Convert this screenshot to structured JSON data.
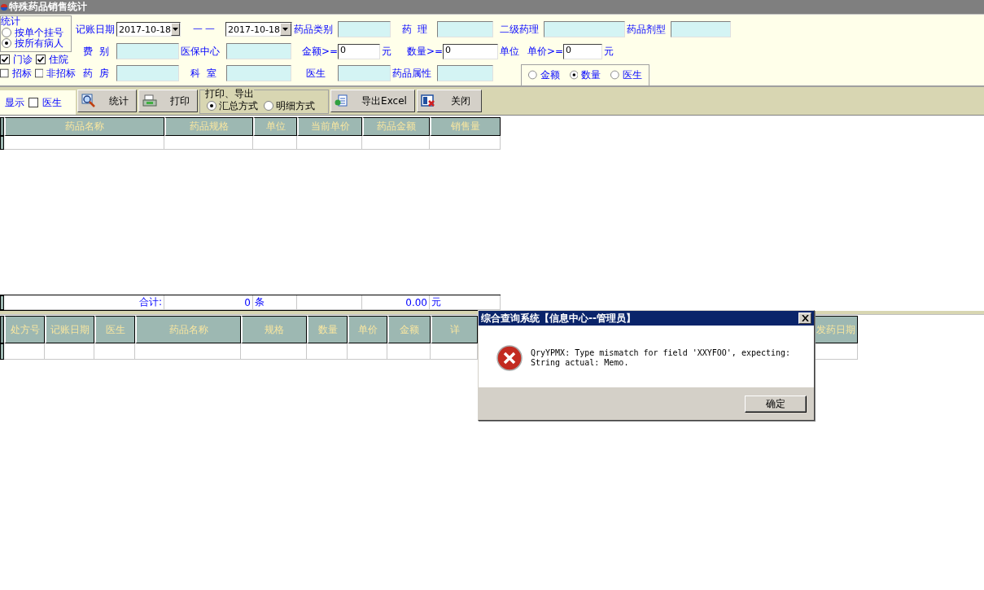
{
  "window": {
    "title": "特殊药品销售统计"
  },
  "stat_group": {
    "legend": "统计",
    "options": [
      {
        "label": "按单个挂号",
        "selected": false
      },
      {
        "label": "按所有病人",
        "selected": true
      }
    ]
  },
  "checkbox_rows": [
    [
      {
        "label": "门诊",
        "checked": true
      },
      {
        "label": "住院",
        "checked": true
      }
    ],
    [
      {
        "label": "招标",
        "checked": false
      },
      {
        "label": "非招标",
        "checked": false
      }
    ]
  ],
  "filter_rows": [
    [
      {
        "kind": "label",
        "text": "记账日期"
      },
      {
        "kind": "date",
        "value": "2017-10-18"
      },
      {
        "kind": "sep",
        "text": "一 一"
      },
      {
        "kind": "date",
        "value": "2017-10-18"
      },
      {
        "kind": "label",
        "text": "药品类别"
      },
      {
        "kind": "field"
      },
      {
        "kind": "label",
        "text": "药  理"
      },
      {
        "kind": "field"
      },
      {
        "kind": "label",
        "text": "二级药理"
      },
      {
        "kind": "field"
      },
      {
        "kind": "label",
        "text": "药品剂型"
      },
      {
        "kind": "field"
      }
    ],
    [
      {
        "kind": "label",
        "text": "费  别"
      },
      {
        "kind": "field"
      },
      {
        "kind": "label",
        "text": "医保中心"
      },
      {
        "kind": "field"
      },
      {
        "kind": "label",
        "text": "金额>="
      },
      {
        "kind": "input",
        "value": "0"
      },
      {
        "kind": "label",
        "text": "元"
      },
      {
        "kind": "label",
        "text": "数量>="
      },
      {
        "kind": "input",
        "value": "0"
      },
      {
        "kind": "label",
        "text": "单位"
      },
      {
        "kind": "label",
        "text": "单价>="
      },
      {
        "kind": "input",
        "value": "0"
      },
      {
        "kind": "label",
        "text": "元"
      }
    ],
    [
      {
        "kind": "label",
        "text": "药  房"
      },
      {
        "kind": "field"
      },
      {
        "kind": "label",
        "text": "科  室"
      },
      {
        "kind": "field"
      },
      {
        "kind": "label",
        "text": "医生"
      },
      {
        "kind": "field"
      },
      {
        "kind": "label",
        "text": "药品属性"
      },
      {
        "kind": "field"
      },
      {
        "kind": "radios",
        "options": [
          {
            "label": "金额",
            "selected": false
          },
          {
            "label": "数量",
            "selected": true
          },
          {
            "label": "医生",
            "selected": false
          }
        ]
      }
    ]
  ],
  "toolbar": {
    "show_label": "显示",
    "show_doctor": {
      "label": "医生",
      "checked": false
    },
    "buttons": [
      {
        "kind": "stats",
        "label": "统计"
      },
      {
        "kind": "print",
        "label": "打印"
      }
    ],
    "output_group": {
      "legend": "打印、导出",
      "options": [
        {
          "label": "汇总方式",
          "selected": true
        },
        {
          "label": "明细方式",
          "selected": false
        }
      ]
    },
    "buttons_after": [
      {
        "kind": "excel",
        "label": "导出Excel"
      },
      {
        "kind": "close",
        "label": "关闭"
      }
    ]
  },
  "summary_table": {
    "columns": [
      "药品名称",
      "药品规格",
      "单位",
      "当前单价",
      "药品金额",
      "销售量"
    ],
    "total_row": {
      "label": "合计:",
      "count": "0",
      "count_unit": "条",
      "amount": "0.00",
      "amount_unit": "元"
    }
  },
  "detail_table": {
    "columns": [
      "处方号",
      "记账日期",
      "医生",
      "药品名称",
      "规格",
      "数量",
      "单价",
      "金额",
      "详",
      "发药日期"
    ]
  },
  "dialog": {
    "title": "综合查询系统【信息中心--管理员】",
    "message": "QryYPMX: Type mismatch for field 'XXYFOO', expecting:\nString actual: Memo.",
    "button": "确定"
  }
}
